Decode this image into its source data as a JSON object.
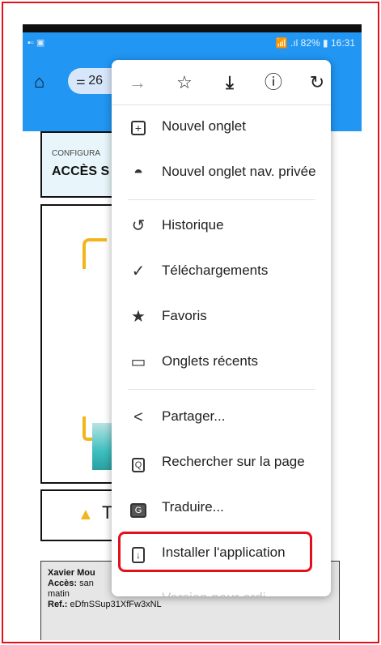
{
  "statusbar": {
    "left": "▪▫ ▣",
    "right": "📶 .ıl 82% ▮ 16:31"
  },
  "toolbar": {
    "url_label": "26"
  },
  "page": {
    "card1_small": "CONFIGURA",
    "card1_big": "ACCÈS S",
    "card3_text": "T",
    "details": {
      "name": "Xavier Mou",
      "access_label": "Accès:",
      "access_value": " san",
      "line3": "matin",
      "ref_label": "Ref.:",
      "ref_value": " eDfnSSup31XfFw3xNL"
    }
  },
  "menu": {
    "top_icons": [
      "arrow-forward-icon",
      "star-icon",
      "download-icon",
      "info-icon",
      "refresh-icon"
    ],
    "items": [
      {
        "label": "Nouvel onglet",
        "icon": "new-tab-icon"
      },
      {
        "label": "Nouvel onglet nav. privée",
        "icon": "incognito-icon"
      },
      {
        "label": "Historique",
        "icon": "history-icon"
      },
      {
        "label": "Téléchargements",
        "icon": "downloads-icon"
      },
      {
        "label": "Favoris",
        "icon": "bookmark-star-icon"
      },
      {
        "label": "Onglets récents",
        "icon": "recent-tabs-icon"
      },
      {
        "label": "Partager...",
        "icon": "share-icon"
      },
      {
        "label": "Rechercher sur la page",
        "icon": "find-in-page-icon"
      },
      {
        "label": "Traduire...",
        "icon": "translate-icon"
      },
      {
        "label": "Installer l'application",
        "icon": "install-app-icon"
      },
      {
        "label": "Version pour ordi",
        "icon": "desktop-site-icon"
      }
    ]
  },
  "colors": {
    "accent": "#2196f3",
    "highlight": "#e3101a",
    "yellow": "#f2b51c"
  }
}
